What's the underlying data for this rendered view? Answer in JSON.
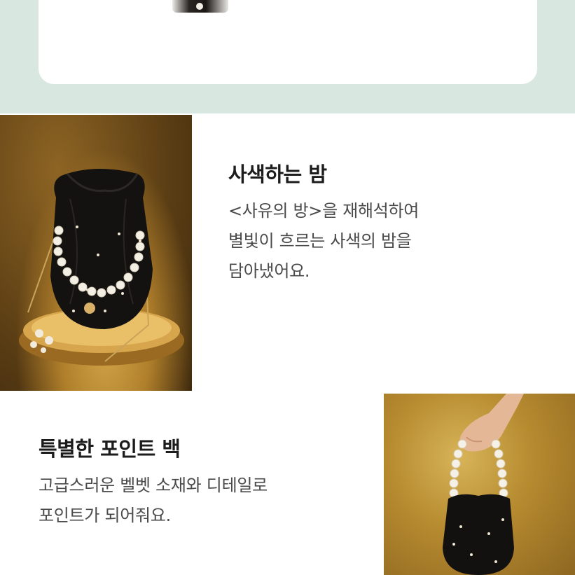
{
  "section1": {
    "title": "사색하는 밤",
    "lines": [
      "<사유의 방>을 재해석하여",
      "별빛이 흐르는 사색의 밤을",
      "담아냈어요."
    ],
    "image_alt": "black velvet pearl drawstring bucket bag on gold pedestal"
  },
  "section2": {
    "title": "특별한 포인트 백",
    "lines": [
      "고급스러운 벨벳 소재와 디테일로",
      "포인트가 되어줘요."
    ],
    "image_alt": "hand holding black velvet bag by pearl strap"
  },
  "colors": {
    "top_band": "#d8e7e0",
    "title_text": "#1c1c1c",
    "body_text": "#4a4a4a",
    "photo_gold": "#b68a2f"
  }
}
